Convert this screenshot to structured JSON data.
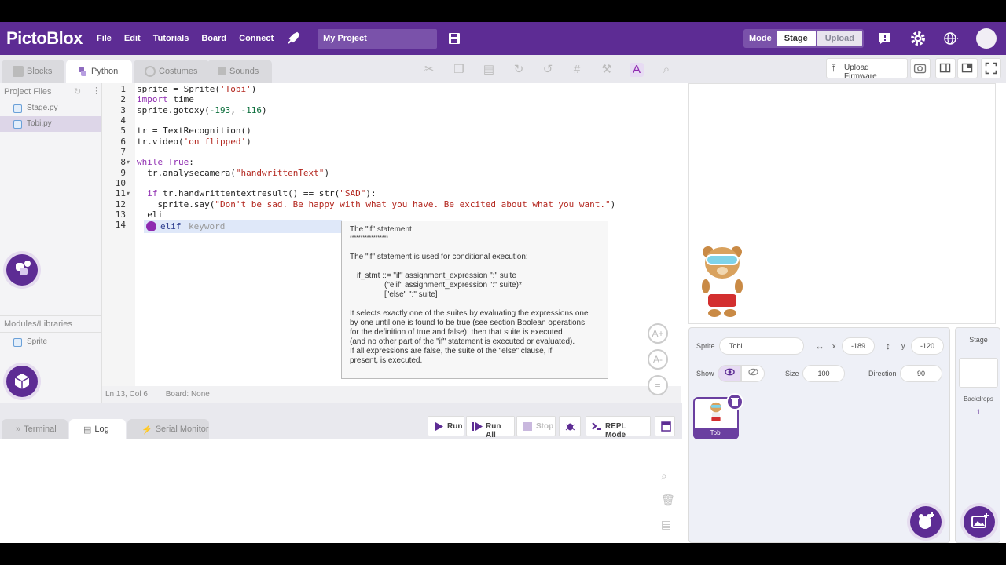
{
  "app": {
    "logo": "PictoBlox",
    "menu": [
      "File",
      "Edit",
      "Tutorials",
      "Board",
      "Connect"
    ],
    "project_name": "My Project",
    "mode_label": "Mode",
    "mode_stage": "Stage",
    "mode_upload": "Upload"
  },
  "tabs": {
    "blocks": "Blocks",
    "python": "Python",
    "costumes": "Costumes",
    "sounds": "Sounds"
  },
  "stage_header": {
    "upload_firmware": "Upload Firmware"
  },
  "files": {
    "header": "Project Files",
    "items": [
      "Stage.py",
      "Tobi.py"
    ],
    "modules_header": "Modules/Libraries",
    "modules": [
      "Sprite"
    ]
  },
  "editor": {
    "line_numbers": [
      "1",
      "2",
      "3",
      "4",
      "5",
      "6",
      "7",
      "8",
      "9",
      "10",
      "11",
      "12",
      "13",
      "14"
    ],
    "status_position": "Ln 13, Col 6",
    "status_board": "Board: None"
  },
  "autocomplete": {
    "word": "elif",
    "kind": "keyword",
    "doc_title": "The \"if\" statement",
    "doc_underline": "******************",
    "doc_body": "The \"if\" statement is used for conditional execution:",
    "doc_grammar_1": "if_stmt ::= \"if\" assignment_expression \":\" suite",
    "doc_grammar_2": "(\"elif\" assignment_expression \":\" suite)*",
    "doc_grammar_3": "[\"else\" \":\" suite]",
    "doc_para_1": "It selects exactly one of the suites by evaluating the expressions one",
    "doc_para_2": "by one until one is found to be true (see section Boolean operations",
    "doc_para_3": "for the definition of true and false); then that suite is executed",
    "doc_para_4": "(and no other part of the \"if\" statement is executed or evaluated).",
    "doc_para_5": "If all expressions are false, the suite of the \"else\" clause, if",
    "doc_para_6": "present, is executed."
  },
  "terminal": {
    "tabs": [
      "Terminal",
      "Log",
      "Serial Monitor"
    ],
    "run": "Run",
    "run_all": "Run All",
    "stop": "Stop",
    "repl": "REPL Mode"
  },
  "sprite_info": {
    "sprite_label": "Sprite",
    "sprite_name": "Tobi",
    "x_label": "x",
    "x": "-189",
    "y_label": "y",
    "y": "-120",
    "show_label": "Show",
    "size_label": "Size",
    "size": "100",
    "direction_label": "Direction",
    "direction": "90",
    "tile_name": "Tobi"
  },
  "stage_panel": {
    "title": "Stage",
    "backdrops_label": "Backdrops",
    "backdrops_count": "1"
  },
  "colors": {
    "brand": "#5d2c94",
    "keyword": "#8e2bb0",
    "string": "#b3261e"
  }
}
